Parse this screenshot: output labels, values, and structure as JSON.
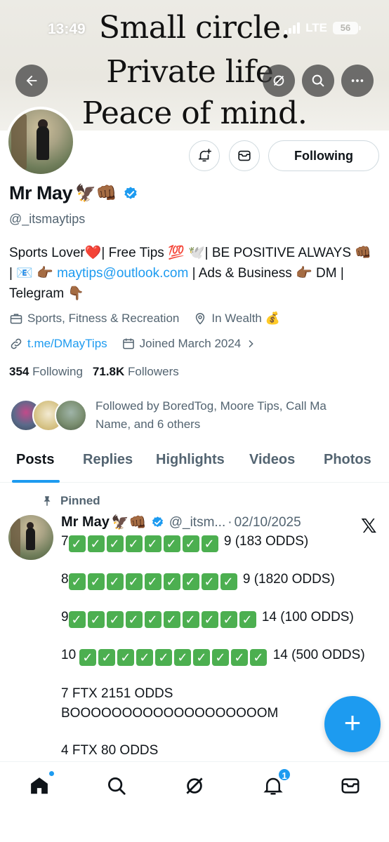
{
  "status_bar": {
    "time": "13:49",
    "network": "LTE",
    "battery": "56"
  },
  "banner": {
    "line1": "Small circle.",
    "line2": "Private life.",
    "line3": "Peace of mind."
  },
  "header_buttons": {
    "back_icon": "arrow-left-icon",
    "grok_icon": "grok-icon",
    "search_icon": "search-icon",
    "more_icon": "more-icon"
  },
  "profile": {
    "display_name": "Mr May",
    "name_emojis": "🦅👊🏾",
    "handle": "@_itsmaytips",
    "follow_label": "Following",
    "bio_part1": "Sports Lover❤️| Free Tips 💯 🕊️| BE POSITIVE ALWAYS 👊🏾 | 📧 👉🏾 ",
    "bio_email": "maytips@outlook.com",
    "bio_part2": " | Ads & Business 👉🏾 DM | Telegram 👇🏾",
    "category": "Sports, Fitness & Recreation",
    "location": "In Wealth 💰",
    "website": "t.me/DMayTips",
    "joined": "Joined March 2024",
    "following_count": "354",
    "following_label": "Following",
    "followers_count": "71.8K",
    "followers_label": "Followers",
    "followed_by": "Followed by BoredTog, Moore Tips, Call Ma Name, and 6 others"
  },
  "tabs": [
    "Posts",
    "Replies",
    "Highlights",
    "Videos",
    "Photos"
  ],
  "post": {
    "pinned_label": "Pinned",
    "author_name": "Mr May",
    "author_emojis": "🦅👊🏾",
    "author_handle": "@_itsm...",
    "separator": "·",
    "date": "02/10/2025",
    "line1_prefix": "7",
    "line1_checks": 8,
    "line1_suffix": " 9 (183 ODDS)",
    "line2_prefix": "8",
    "line2_checks": 9,
    "line2_suffix": " 9 (1820 ODDS)",
    "line3_prefix": "9",
    "line3_checks": 10,
    "line3_suffix": " 14 (100 ODDS)",
    "line4_prefix": "10 ",
    "line4_checks": 10,
    "line4_suffix": " 14 (500 ODDS)",
    "line5": "7 FTX 2151 ODDS",
    "line6": "BOOOOOOOOOOOOOOOOOOOM",
    "line7": "4 FTX 80 ODDS"
  },
  "fab": {
    "label": "+"
  },
  "bottom_nav": {
    "notifications_badge": "1"
  },
  "colors": {
    "accent": "#1d9bf0",
    "text_primary": "#0f1419",
    "text_secondary": "#536471",
    "check_green": "#4caf50"
  }
}
